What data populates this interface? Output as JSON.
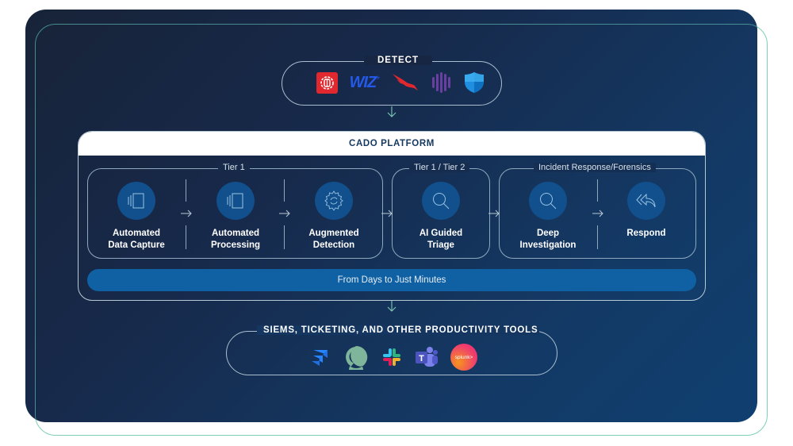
{
  "detect": {
    "title": "DETECT",
    "logos": [
      {
        "name": "red-gear-shield-logo",
        "color": "#e0282e"
      },
      {
        "name": "wiz-logo",
        "text": "WIZ",
        "color": "#2459e8"
      },
      {
        "name": "crowdstrike-falcon-logo",
        "color": "#e0282e"
      },
      {
        "name": "purple-bars-logo",
        "color": "#6a3fa0"
      },
      {
        "name": "microsoft-defender-shield-logo",
        "color": "#1f8ee0"
      }
    ]
  },
  "platform": {
    "title": "CADO PLATFORM",
    "groups": [
      {
        "label": "Tier 1"
      },
      {
        "label": "Tier 1 / Tier 2"
      },
      {
        "label": "Incident Response/Forensics"
      }
    ],
    "steps": [
      {
        "line1": "Automated",
        "line2": "Data Capture",
        "icon": "capture-icon"
      },
      {
        "line1": "Automated",
        "line2": "Processing",
        "icon": "processing-icon"
      },
      {
        "line1": "Augmented",
        "line2": "Detection",
        "icon": "gear-sync-icon"
      },
      {
        "line1": "AI Guided",
        "line2": "Triage",
        "icon": "search-icon"
      },
      {
        "line1": "Deep",
        "line2": "Investigation",
        "icon": "search-icon"
      },
      {
        "line1": "Respond",
        "line2": "",
        "icon": "reply-all-icon"
      }
    ],
    "banner": "From Days to Just Minutes"
  },
  "tools": {
    "title": "SIEMS, TICKETING, AND OTHER PRODUCTIVITY TOOLS",
    "logos": [
      {
        "name": "jira-logo",
        "color": "#2684ff"
      },
      {
        "name": "green-ring-logo",
        "color": "#7fb59a"
      },
      {
        "name": "slack-logo"
      },
      {
        "name": "microsoft-teams-logo",
        "text": "T",
        "color": "#5059c9"
      },
      {
        "name": "splunk-logo",
        "text": "splunk>",
        "color": "#f0436a"
      }
    ]
  },
  "colors": {
    "accent_outline": "#7fd1b4",
    "panel_dark": "#172338",
    "panel_blue": "#0f3f70",
    "step_circle": "#11508c",
    "banner": "#1061a3"
  }
}
